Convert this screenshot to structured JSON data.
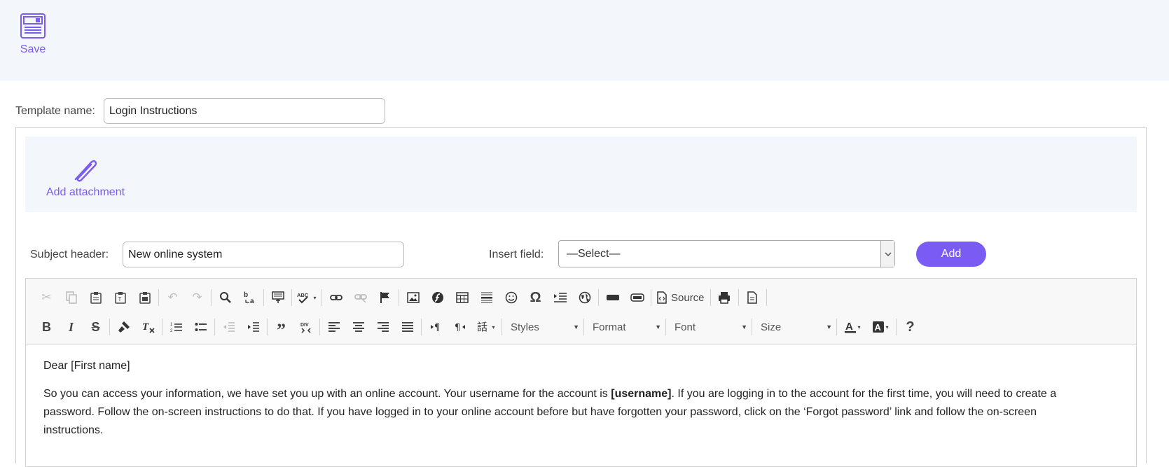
{
  "topbar": {
    "save_label": "Save",
    "save_icon": "save-icon"
  },
  "template": {
    "label": "Template name:",
    "value": "Login Instructions"
  },
  "attachment": {
    "label": "Add attachment",
    "icon": "paperclip-icon"
  },
  "subject": {
    "label": "Subject header:",
    "value": "New online system"
  },
  "insert_field": {
    "label": "Insert field:",
    "selected": "—Select—",
    "add_label": "Add"
  },
  "toolbar": {
    "source_label": "Source",
    "styles_label": "Styles",
    "format_label": "Format",
    "font_label": "Font",
    "size_label": "Size",
    "help_label": "?"
  },
  "body": {
    "greeting": "Dear [First name]",
    "para_before": "So you can access your information, we have set you up with an online account. Your username for the account is ",
    "para_bold": "[username]",
    "para_after": ". If you are logging in to the account for the first time, you will need to create a password. Follow the on-screen instructions to do that. If you have logged in to your online account before but have forgotten your password, click on the ‘Forgot password’ link and follow the on-screen instructions."
  },
  "colors": {
    "accent": "#7a5cf5",
    "panel_bg": "#f3f6fa",
    "toolbar_bg": "#f8f8f8"
  }
}
